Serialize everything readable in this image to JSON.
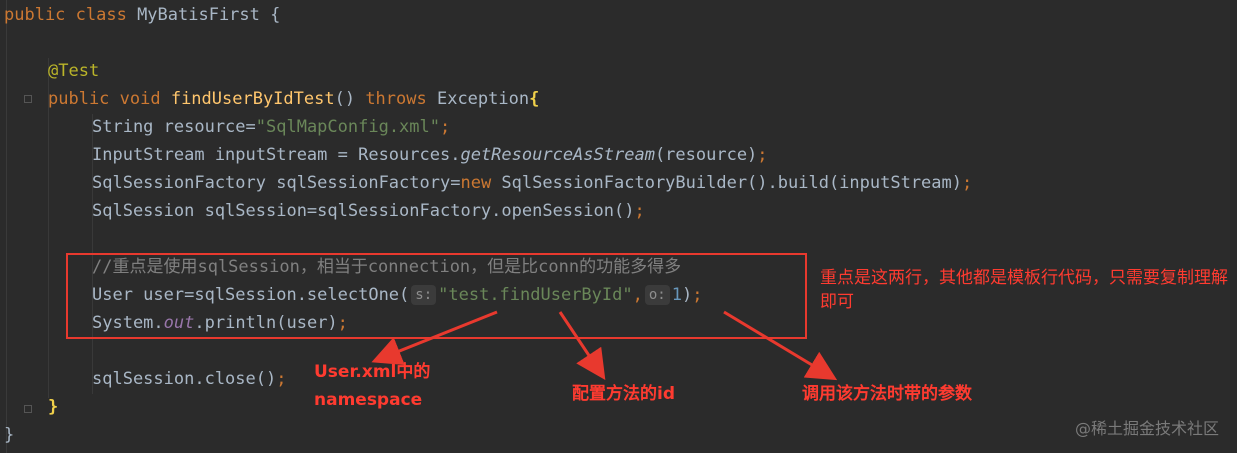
{
  "code": {
    "l1": {
      "kw": "public class ",
      "name": "MyBatisFirst {"
    },
    "l2": {
      "ann": "@Test"
    },
    "l3": {
      "kw1": "public void ",
      "fn": "findUserByIdTest",
      "mid": "() ",
      "kw2": "throws ",
      "ex": "Exception",
      "brace": "{"
    },
    "l4": {
      "a": "String resource=",
      "s": "\"SqlMapConfig.xml\"",
      "semi": ";"
    },
    "l5": {
      "a": "InputStream inputStream = Resources.",
      "m": "getResourceAsStream",
      "b": "(resource)",
      "semi": ";"
    },
    "l6": {
      "a": "SqlSessionFactory sqlSessionFactory=",
      "kw": "new ",
      "b": "SqlSessionFactoryBuilder().build(inputStream)",
      "semi": ";"
    },
    "l7": {
      "a": "SqlSession sqlSession=sqlSessionFactory.openSession()",
      "semi": ";"
    },
    "l8": {
      "cmt": "//重点是使用sqlSession，相当于connection，但是比conn的功能多得多"
    },
    "l9": {
      "a": "User user=sqlSession.selectOne(",
      "hint1": "s:",
      "s": "\"test.findUserById\"",
      "comma": ",",
      "hint2": "o:",
      "n": "1",
      "end": ")",
      "semi": ";"
    },
    "l10": {
      "a": "System.",
      "f": "out",
      "b": ".println(user)",
      "semi": ";"
    },
    "l11": {
      "a": "sqlSession.close()",
      "semi": ";"
    },
    "l12": {
      "brace": "}"
    },
    "l13": {
      "brace": "}"
    }
  },
  "annotations": {
    "side_note": "重点是这两行，其他都是模板行代码，只需要复制理解即可",
    "note_namespace_1": "User.xml中的",
    "note_namespace_2": "namespace",
    "note_id": "配置方法的id",
    "note_param": "调用该方法时带的参数"
  },
  "colors": {
    "background": "#2b2b2b",
    "annotation_red": "#e8392e",
    "keyword": "#cc7832",
    "string": "#6a8759"
  },
  "watermark": "@稀土掘金技术社区"
}
